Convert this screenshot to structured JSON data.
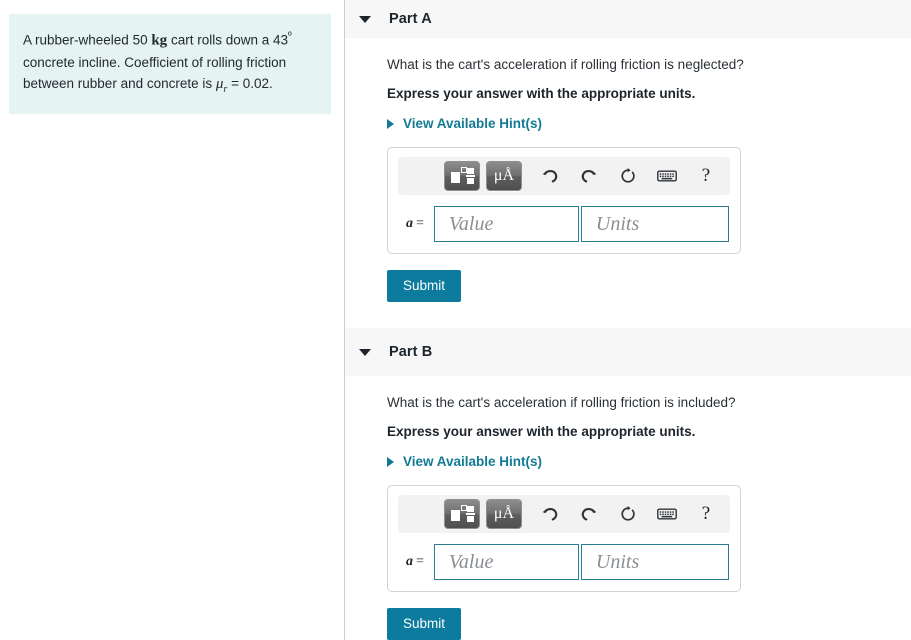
{
  "problem": {
    "text_before_mass": "A rubber-wheeled 50 ",
    "mass_unit": "kg",
    "text_after_mass": " cart rolls down a 43",
    "degree_symbol": "º",
    "line2": "concrete incline. Coefficient of rolling friction",
    "line3_before_mu": "between rubber and concrete is ",
    "mu_symbol": "μ",
    "mu_subscript": "r",
    "mu_value": " = 0.02."
  },
  "parts": [
    {
      "title": "Part A",
      "caret_icon": "caret-down-icon",
      "question": "What is the cart's acceleration if rolling friction is neglected?",
      "instruction": "Express your answer with the appropriate units.",
      "hints_label": "View Available Hint(s)",
      "hints_caret_icon": "caret-right-icon",
      "answer": {
        "variable": "a",
        "equals": "=",
        "value_placeholder": "Value",
        "units_placeholder": "Units",
        "value_text": "",
        "units_text": ""
      },
      "toolbar": {
        "template_button": "template-icon",
        "units_button_label": "μÅ",
        "undo_icon": "undo-icon",
        "redo_icon": "redo-icon",
        "reset_icon": "reset-icon",
        "keyboard_icon": "keyboard-icon",
        "help_label": "?"
      },
      "submit_label": "Submit"
    },
    {
      "title": "Part B",
      "caret_icon": "caret-down-icon",
      "question": "What is the cart's acceleration if rolling friction is included?",
      "instruction": "Express your answer with the appropriate units.",
      "hints_label": "View Available Hint(s)",
      "hints_caret_icon": "caret-right-icon",
      "answer": {
        "variable": "a",
        "equals": "=",
        "value_placeholder": "Value",
        "units_placeholder": "Units",
        "value_text": "",
        "units_text": ""
      },
      "toolbar": {
        "template_button": "template-icon",
        "units_button_label": "μÅ",
        "undo_icon": "undo-icon",
        "redo_icon": "redo-icon",
        "reset_icon": "reset-icon",
        "keyboard_icon": "keyboard-icon",
        "help_label": "?"
      },
      "submit_label": "Submit"
    }
  ],
  "colors": {
    "accent_teal": "#137a94",
    "submit_blue": "#0c7b9e",
    "problem_card_bg": "#e6f3f3",
    "header_bg": "#f7f7f7",
    "field_border": "#2a7e91"
  }
}
